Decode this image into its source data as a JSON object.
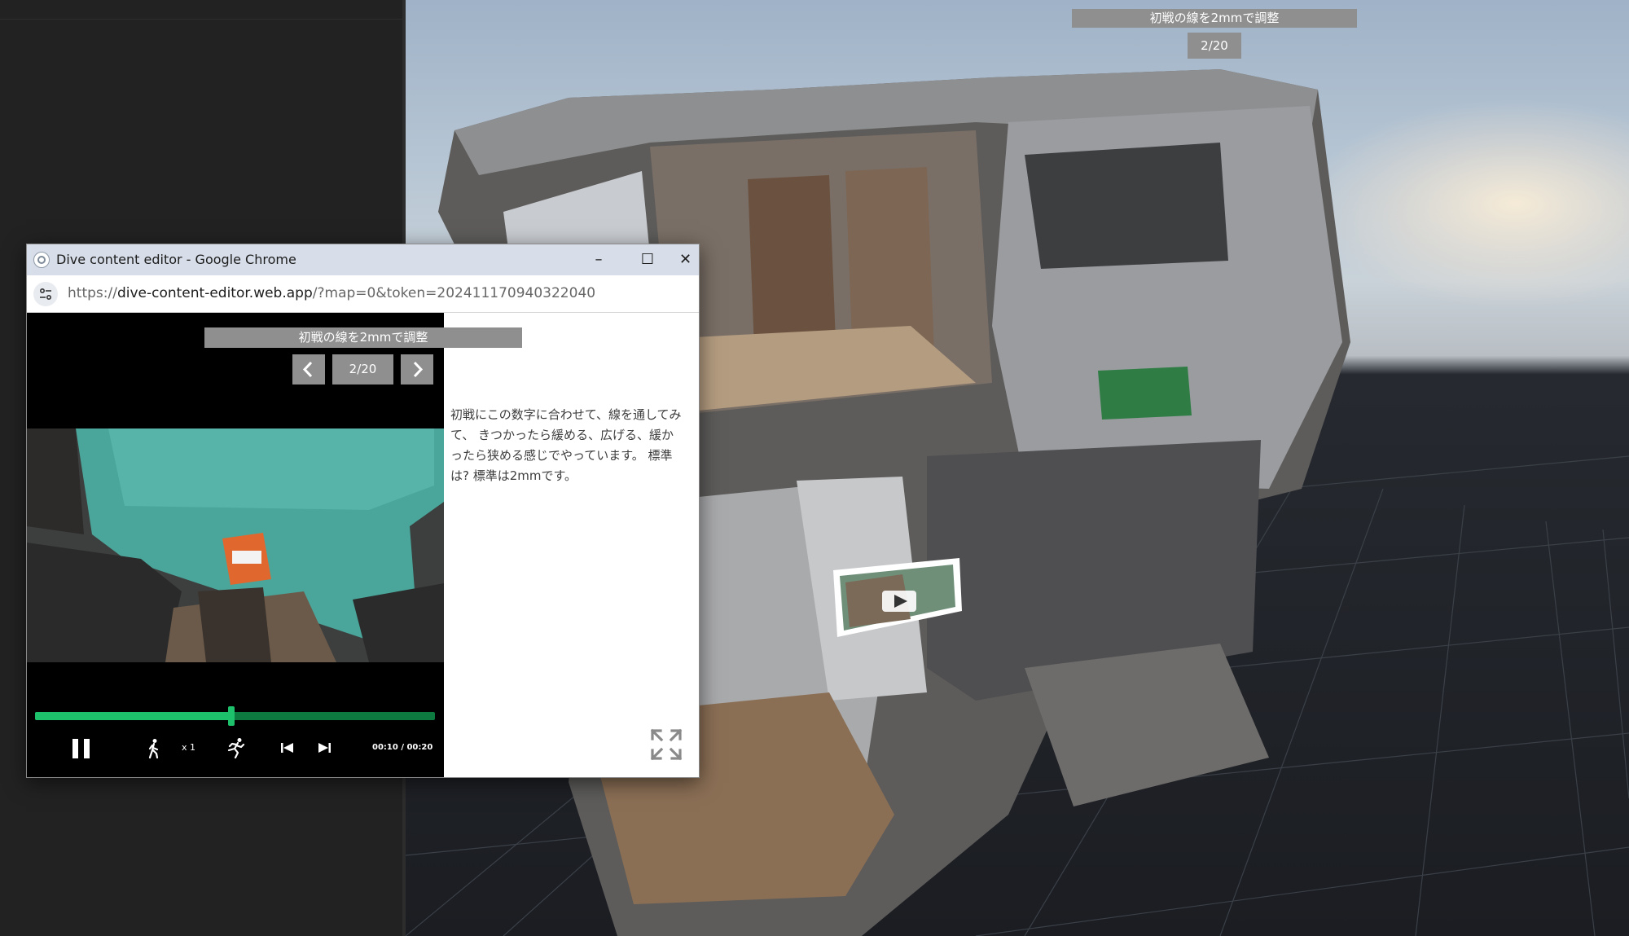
{
  "viewport": {
    "slide_title": "初戦の線を2mmで調整",
    "slide_counter": "2/20"
  },
  "window": {
    "title": "Dive content editor - Google Chrome",
    "controls": {
      "minimize": "–",
      "maximize": "☐",
      "close": "✕"
    },
    "url_scheme": "https://",
    "url_host": "dive-content-editor.web.app",
    "url_path": "/?map=0&token=20241117094032204​0"
  },
  "player": {
    "title": "初戦の線を2mmで調整",
    "counter": "2/20",
    "speed": "x 1",
    "time": "00:10 / 00:20",
    "progress": 0.49,
    "progress_color": "#1ec16b",
    "track_color": "#0d7a3f",
    "icons": [
      "chevron-left-icon",
      "chevron-right-icon",
      "pause-icon",
      "walk-icon",
      "run-icon",
      "rewind-icon",
      "fast-forward-icon",
      "fullscreen-icon"
    ]
  },
  "description": "初戦にこの数字に合わせて、線を通してみて、 きつかったら緩める、広げる、緩かったら狭める感じでやっています。 標準は? 標準は2mmです。"
}
